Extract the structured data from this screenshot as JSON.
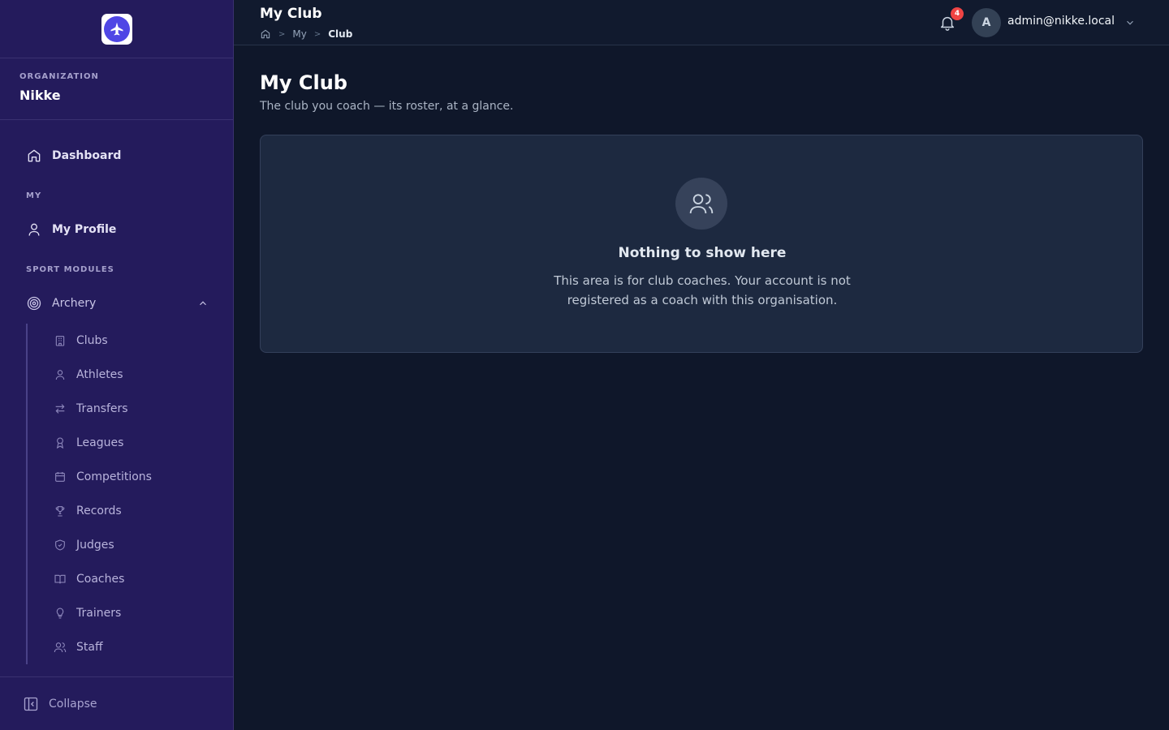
{
  "sidebar": {
    "logo_icon": "plane-logo-icon",
    "org_label": "ORGANIZATION",
    "org_name": "Nikke",
    "dashboard_label": "Dashboard",
    "section_my": "MY",
    "profile_label": "My Profile",
    "section_sport": "SPORT MODULES",
    "archery_label": "Archery",
    "sub_items": [
      {
        "label": "Clubs",
        "icon": "building-icon"
      },
      {
        "label": "Athletes",
        "icon": "user-icon"
      },
      {
        "label": "Transfers",
        "icon": "arrows-icon"
      },
      {
        "label": "Leagues",
        "icon": "award-icon"
      },
      {
        "label": "Competitions",
        "icon": "calendar-icon"
      },
      {
        "label": "Records",
        "icon": "trophy-icon"
      },
      {
        "label": "Judges",
        "icon": "shield-check-icon"
      },
      {
        "label": "Coaches",
        "icon": "book-icon"
      },
      {
        "label": "Trainers",
        "icon": "lightbulb-icon"
      },
      {
        "label": "Staff",
        "icon": "users-icon"
      }
    ],
    "collapse_label": "Collapse"
  },
  "header": {
    "title": "My Club",
    "breadcrumb": [
      "My",
      "Club"
    ],
    "notification_count": "4",
    "avatar_initial": "A",
    "user_email": "admin@nikke.local"
  },
  "main": {
    "title": "My Club",
    "subtitle": "The club you coach — its roster, at a glance.",
    "empty_title": "Nothing to show here",
    "empty_text": "This area is for club coaches. Your account is not registered as a coach with this organisation."
  },
  "colors": {
    "sidebar_bg": "#241b5c",
    "main_bg": "#0f172a",
    "card_bg": "#1d2940",
    "badge": "#ef4444"
  }
}
